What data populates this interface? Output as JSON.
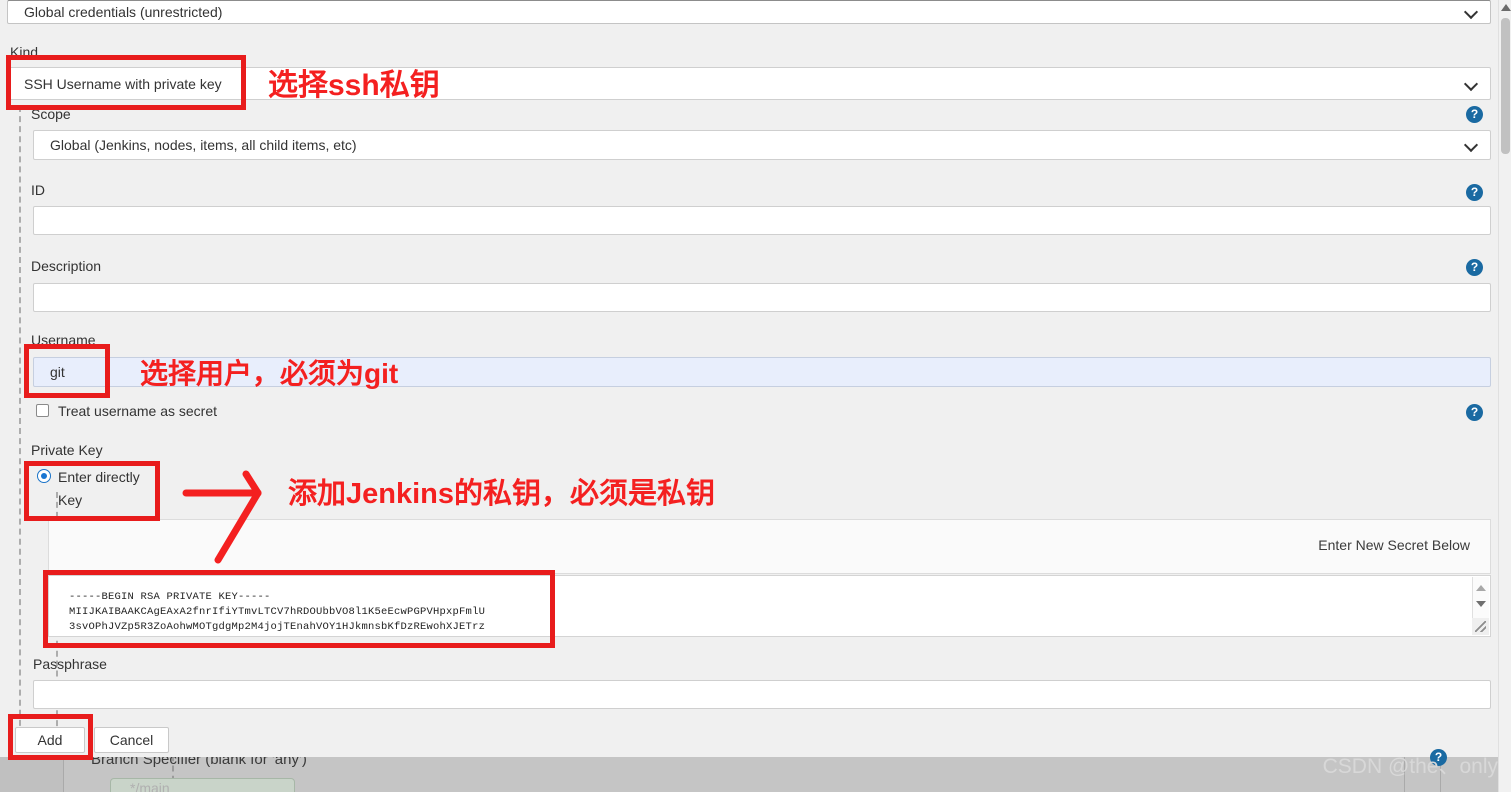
{
  "dialog": {
    "domain_select": {
      "value": "Global credentials (unrestricted)"
    },
    "kind": {
      "label": "Kind",
      "value": "SSH Username with private key"
    },
    "scope": {
      "label": "Scope",
      "value": "Global (Jenkins, nodes, items, all child items, etc)"
    },
    "id": {
      "label": "ID",
      "value": "",
      "placeholder": ""
    },
    "description": {
      "label": "Description",
      "value": "",
      "placeholder": ""
    },
    "username": {
      "label": "Username",
      "value": "git",
      "placeholder": ""
    },
    "treat_secret": {
      "label": "Treat username as secret",
      "checked": false
    },
    "private_key": {
      "label": "Private Key",
      "radio_label": "Enter directly",
      "key_label": "Key",
      "secret_hint": "Enter New Secret Below",
      "key_text": "-----BEGIN RSA PRIVATE KEY-----\nMIIJKAIBAAKCAgEAxA2fnrIfiYTmvLTCV7hRDOUbbVO8l1K5eEcwPGPVHpxpFmlU\n3svOPhJVZp5R3ZoAohwMOTgdgMp2M4jojTEnahVOY1HJkmnsbKfDzREwohXJETrz"
    },
    "passphrase": {
      "label": "Passphrase",
      "value": "",
      "placeholder": ""
    },
    "buttons": {
      "add": "Add",
      "cancel": "Cancel"
    },
    "help_icon": "?"
  },
  "backdrop": {
    "branch_label": "Branch Specifier (blank for 'any')",
    "branch_value": "*/main"
  },
  "annotations": [
    {
      "text": "选择ssh私钥"
    },
    {
      "text": "选择用户，必须为git"
    },
    {
      "text": "添加Jenkins的私钥，必须是私钥"
    }
  ],
  "watermark": {
    "text": "CSDN @the、only"
  },
  "colors": {
    "annotation_red": "#f42020",
    "help_blue": "#1a6aa2",
    "autofill_blue": "#e8eefc",
    "radio_blue": "#1976d2"
  }
}
